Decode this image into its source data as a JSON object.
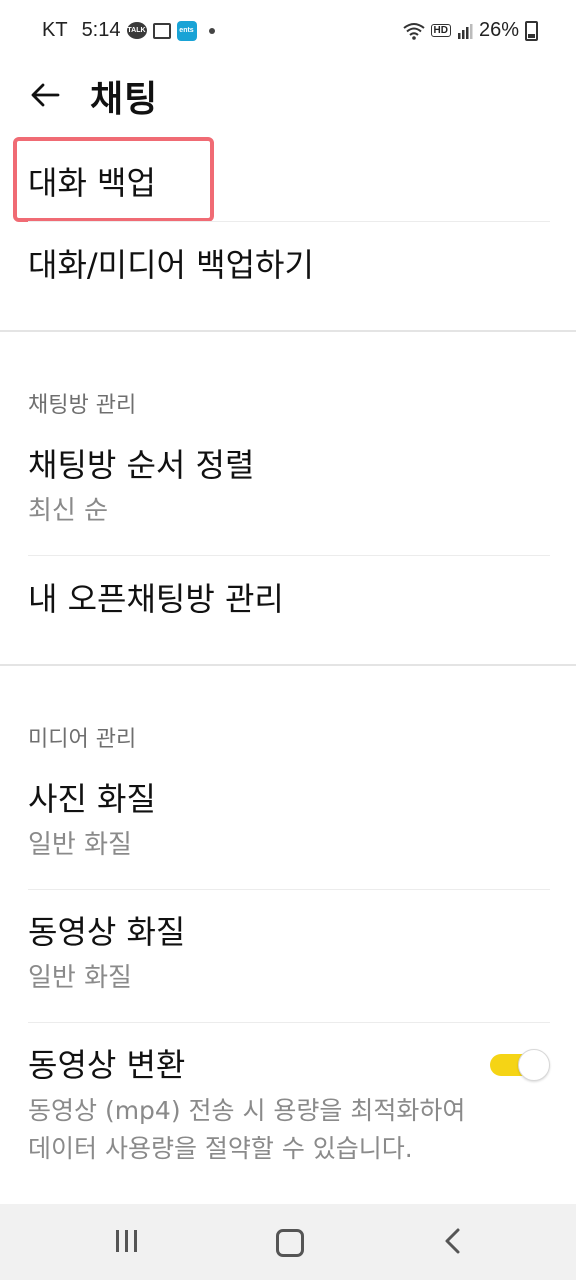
{
  "status_bar": {
    "carrier": "KT",
    "time": "5:14",
    "talk_badge": "TALK",
    "ents_badge": "ents",
    "hd_badge": "HD",
    "battery": "26%"
  },
  "header": {
    "title": "채팅"
  },
  "backup": {
    "title": "대화 백업",
    "action": "대화/미디어 백업하기"
  },
  "chatroom_section": {
    "label": "채팅방 관리",
    "sort_title": "채팅방 순서 정렬",
    "sort_value": "최신 순",
    "open_chat": "내 오픈채팅방 관리"
  },
  "media_section": {
    "label": "미디어 관리",
    "photo_quality_title": "사진 화질",
    "photo_quality_value": "일반 화질",
    "video_quality_title": "동영상 화질",
    "video_quality_value": "일반 화질",
    "video_convert_title": "동영상 변환",
    "video_convert_desc_1": "동영상 (mp4) 전송 시 용량을 최적화하여",
    "video_convert_desc_2": "데이터 사용량을 절약할 수 있습니다.",
    "video_convert_enabled": true
  },
  "colors": {
    "highlight": "#f06b74",
    "toggle_on": "#f5d415"
  },
  "icons": {
    "back": "arrow-left-icon",
    "recent": "recent-apps-icon",
    "home": "home-icon",
    "nav_back": "chevron-left-icon"
  }
}
